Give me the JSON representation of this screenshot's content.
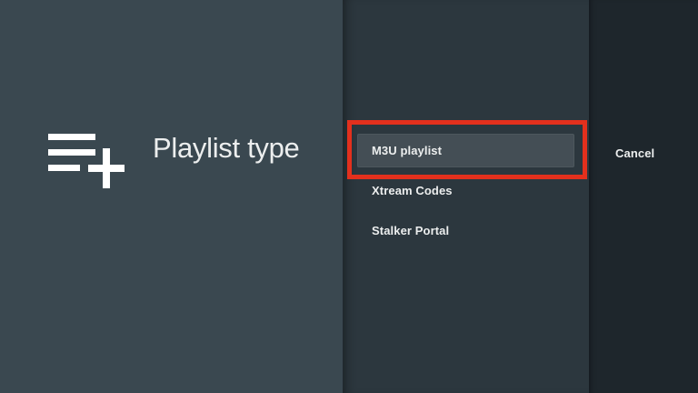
{
  "dialog": {
    "title": "Playlist type",
    "icon": "playlist-add-icon",
    "options": [
      {
        "label": "M3U playlist",
        "focused": true
      },
      {
        "label": "Xtream Codes",
        "focused": false
      },
      {
        "label": "Stalker Portal",
        "focused": false
      }
    ],
    "actions": [
      {
        "label": "Cancel"
      }
    ]
  },
  "annotation": {
    "type": "highlight-box",
    "target": "M3U playlist",
    "color": "#e3301d"
  },
  "colors": {
    "panel_left_bg": "#3a4850",
    "panel_middle_bg": "#2c373e",
    "panel_right_bg": "#1e262c",
    "focused_item_bg": "#444e55",
    "annotation_red": "#e3301d",
    "text_primary": "#eceeee",
    "icon_white": "#ffffff"
  }
}
